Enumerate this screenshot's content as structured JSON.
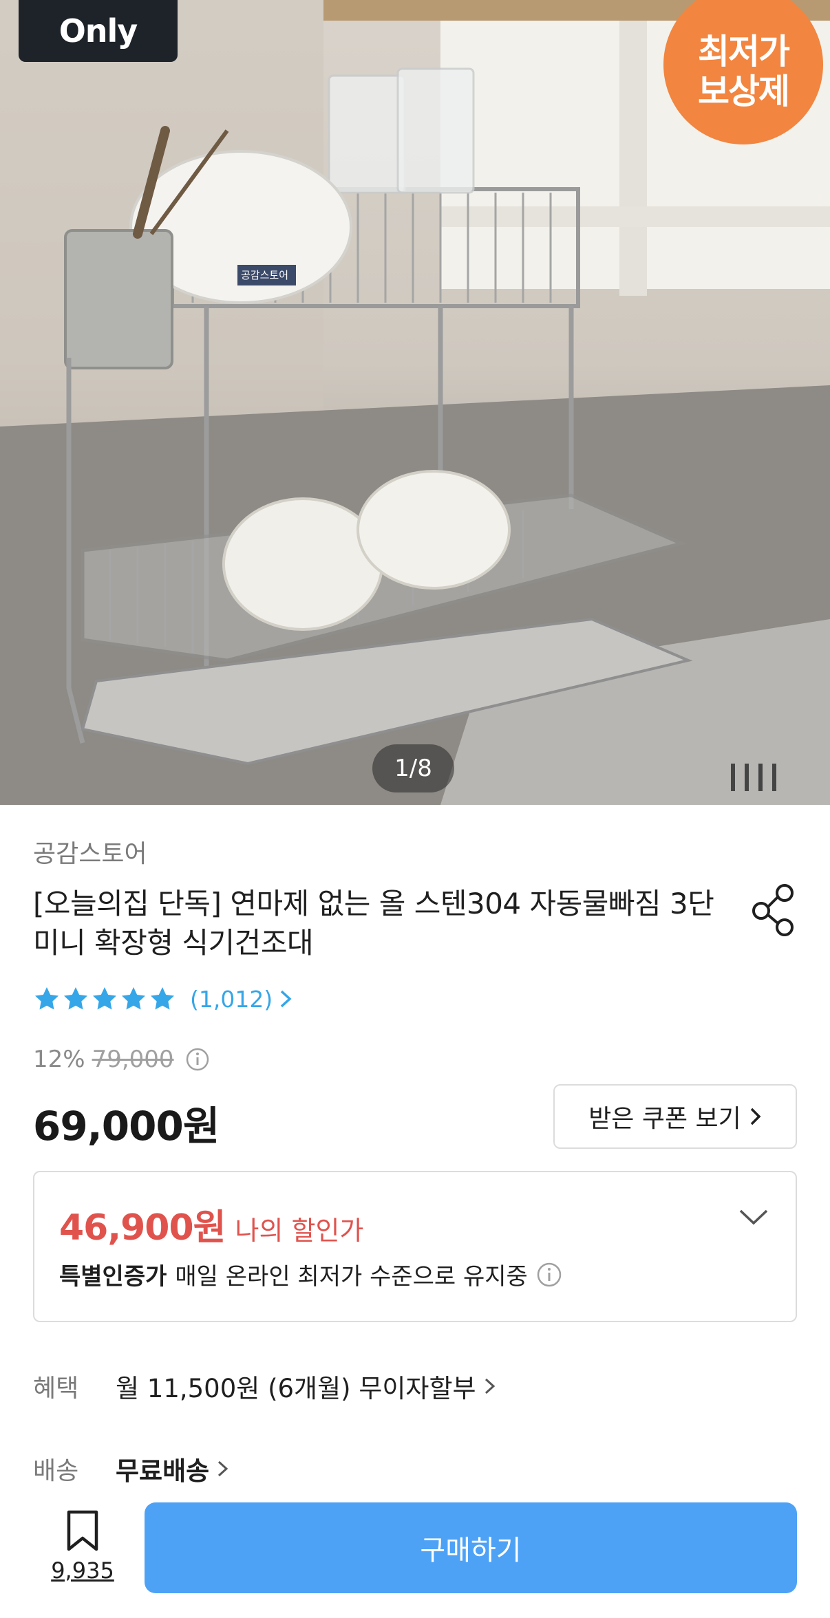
{
  "gallery": {
    "only_badge": "Only",
    "lowest_price_badge_line1": "최저가",
    "lowest_price_badge_line2": "보상제",
    "counter": "1/8",
    "product_tag_text": "공감스토어"
  },
  "product": {
    "store": "공감스토어",
    "title": "[오늘의집 단독] 연마제 없는 올 스텐304 자동물빠짐 3단 미니 확장형 식기건조대",
    "rating_stars": 5,
    "review_count": "(1,012)",
    "discount_rate": "12%",
    "original_price": "79,000",
    "price": "69,000원",
    "coupon_button": "받은 쿠폰 보기"
  },
  "my_price": {
    "value": "46,900원",
    "label": "나의 할인가",
    "special_tag": "특별인증가",
    "special_text": "매일 온라인 최저가 수준으로 유지중"
  },
  "benefit": {
    "label": "혜택",
    "value": "월 11,500원 (6개월) 무이자할부"
  },
  "shipping": {
    "label": "배송",
    "value": "무료배송"
  },
  "bottom": {
    "bookmark_count": "9,935",
    "buy_button": "구매하기"
  },
  "colors": {
    "accent_blue": "#4da2f6",
    "discount_red": "#e0534d",
    "star_blue": "#35a6e8",
    "badge_orange": "#f2853f"
  }
}
